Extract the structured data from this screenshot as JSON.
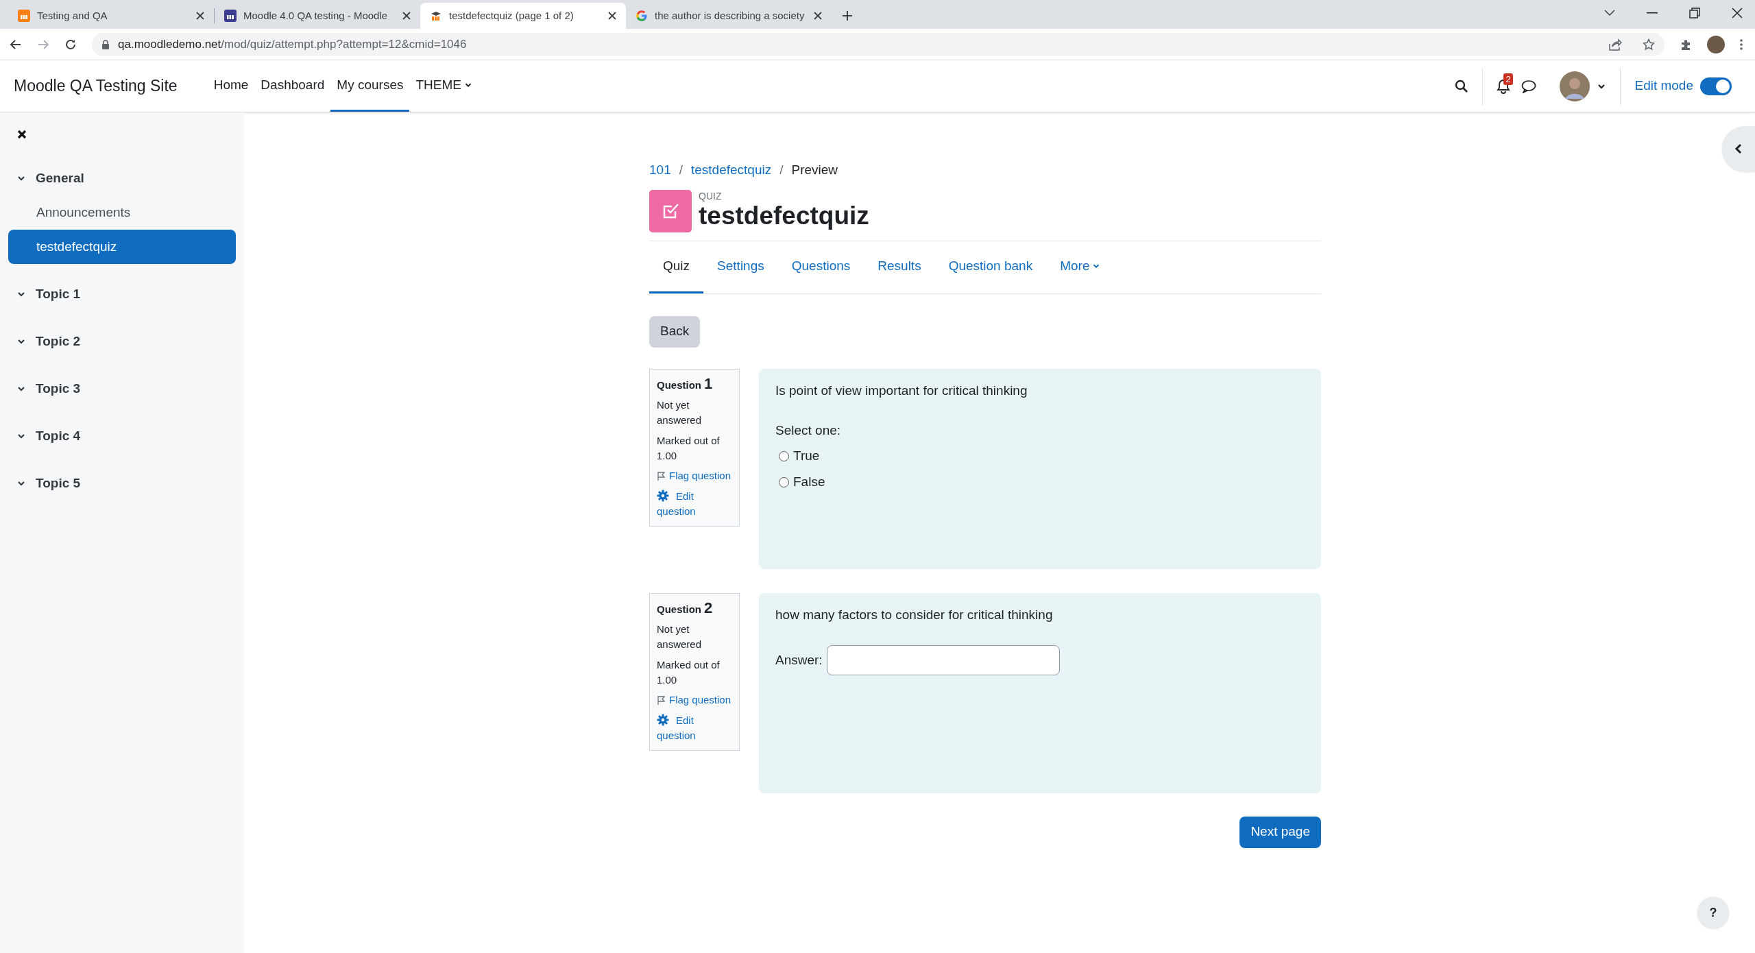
{
  "browser": {
    "tabs": [
      {
        "title": "Testing and QA",
        "selected": false
      },
      {
        "title": "Moodle 4.0 QA testing - Moodle",
        "selected": false
      },
      {
        "title": "testdefectquiz (page 1 of 2)",
        "selected": true
      },
      {
        "title": "the author is describing a society",
        "selected": false
      }
    ],
    "url_host": "qa.moodledemo.net",
    "url_path": "/mod/quiz/attempt.php?attempt=12&cmid=1046"
  },
  "site": {
    "name": "Moodle QA Testing Site",
    "nav": [
      {
        "label": "Home",
        "selected": false,
        "has_menu": false
      },
      {
        "label": "Dashboard",
        "selected": false,
        "has_menu": false
      },
      {
        "label": "My courses",
        "selected": true,
        "has_menu": false
      },
      {
        "label": "THEME",
        "selected": false,
        "has_menu": true
      }
    ],
    "notification_count": "2",
    "edit_mode": {
      "label": "Edit mode",
      "on": true
    }
  },
  "sidebar": {
    "items": [
      {
        "label": "General",
        "kind": "section",
        "expanded": true,
        "selected": false
      },
      {
        "label": "Announcements",
        "kind": "activity",
        "selected": false
      },
      {
        "label": "testdefectquiz",
        "kind": "activity",
        "selected": true
      },
      {
        "label": "Topic 1",
        "kind": "section",
        "expanded": true,
        "selected": false
      },
      {
        "label": "Topic 2",
        "kind": "section",
        "expanded": true,
        "selected": false
      },
      {
        "label": "Topic 3",
        "kind": "section",
        "expanded": true,
        "selected": false
      },
      {
        "label": "Topic 4",
        "kind": "section",
        "expanded": true,
        "selected": false
      },
      {
        "label": "Topic 5",
        "kind": "section",
        "expanded": true,
        "selected": false
      }
    ]
  },
  "breadcrumb": [
    {
      "label": "101",
      "kind": "link"
    },
    {
      "separator": "/",
      "label": "testdefectquiz",
      "kind": "link"
    },
    {
      "separator": "/",
      "label": "Preview",
      "kind": "current"
    }
  ],
  "header": {
    "type_label": "QUIZ",
    "title": "testdefectquiz"
  },
  "tabs": [
    {
      "label": "Quiz",
      "selected": true,
      "has_menu": false
    },
    {
      "label": "Settings",
      "selected": false,
      "has_menu": false
    },
    {
      "label": "Questions",
      "selected": false,
      "has_menu": false
    },
    {
      "label": "Results",
      "selected": false,
      "has_menu": false
    },
    {
      "label": "Question bank",
      "selected": false,
      "has_menu": false
    },
    {
      "label": "More",
      "selected": false,
      "has_menu": true
    }
  ],
  "back_button": "Back",
  "questions": [
    {
      "kind": "choice",
      "heading": "Question",
      "number": "1",
      "status": "Not yet answered",
      "marks": "Marked out of 1.00",
      "flag": "Flag question",
      "edit": "Edit question",
      "text": "Is point of view important for critical thinking",
      "prompt": "Select one:",
      "options": [
        {
          "label": "True",
          "selected": false
        },
        {
          "label": "False",
          "selected": false
        }
      ]
    },
    {
      "kind": "short_answer",
      "heading": "Question",
      "number": "2",
      "status": "Not yet answered",
      "marks": "Marked out of 1.00",
      "flag": "Flag question",
      "edit": "Edit question",
      "text": "how many factors to consider for critical thinking",
      "answer_label": "Answer:"
    }
  ],
  "next_button": "Next page",
  "help_button": "?"
}
